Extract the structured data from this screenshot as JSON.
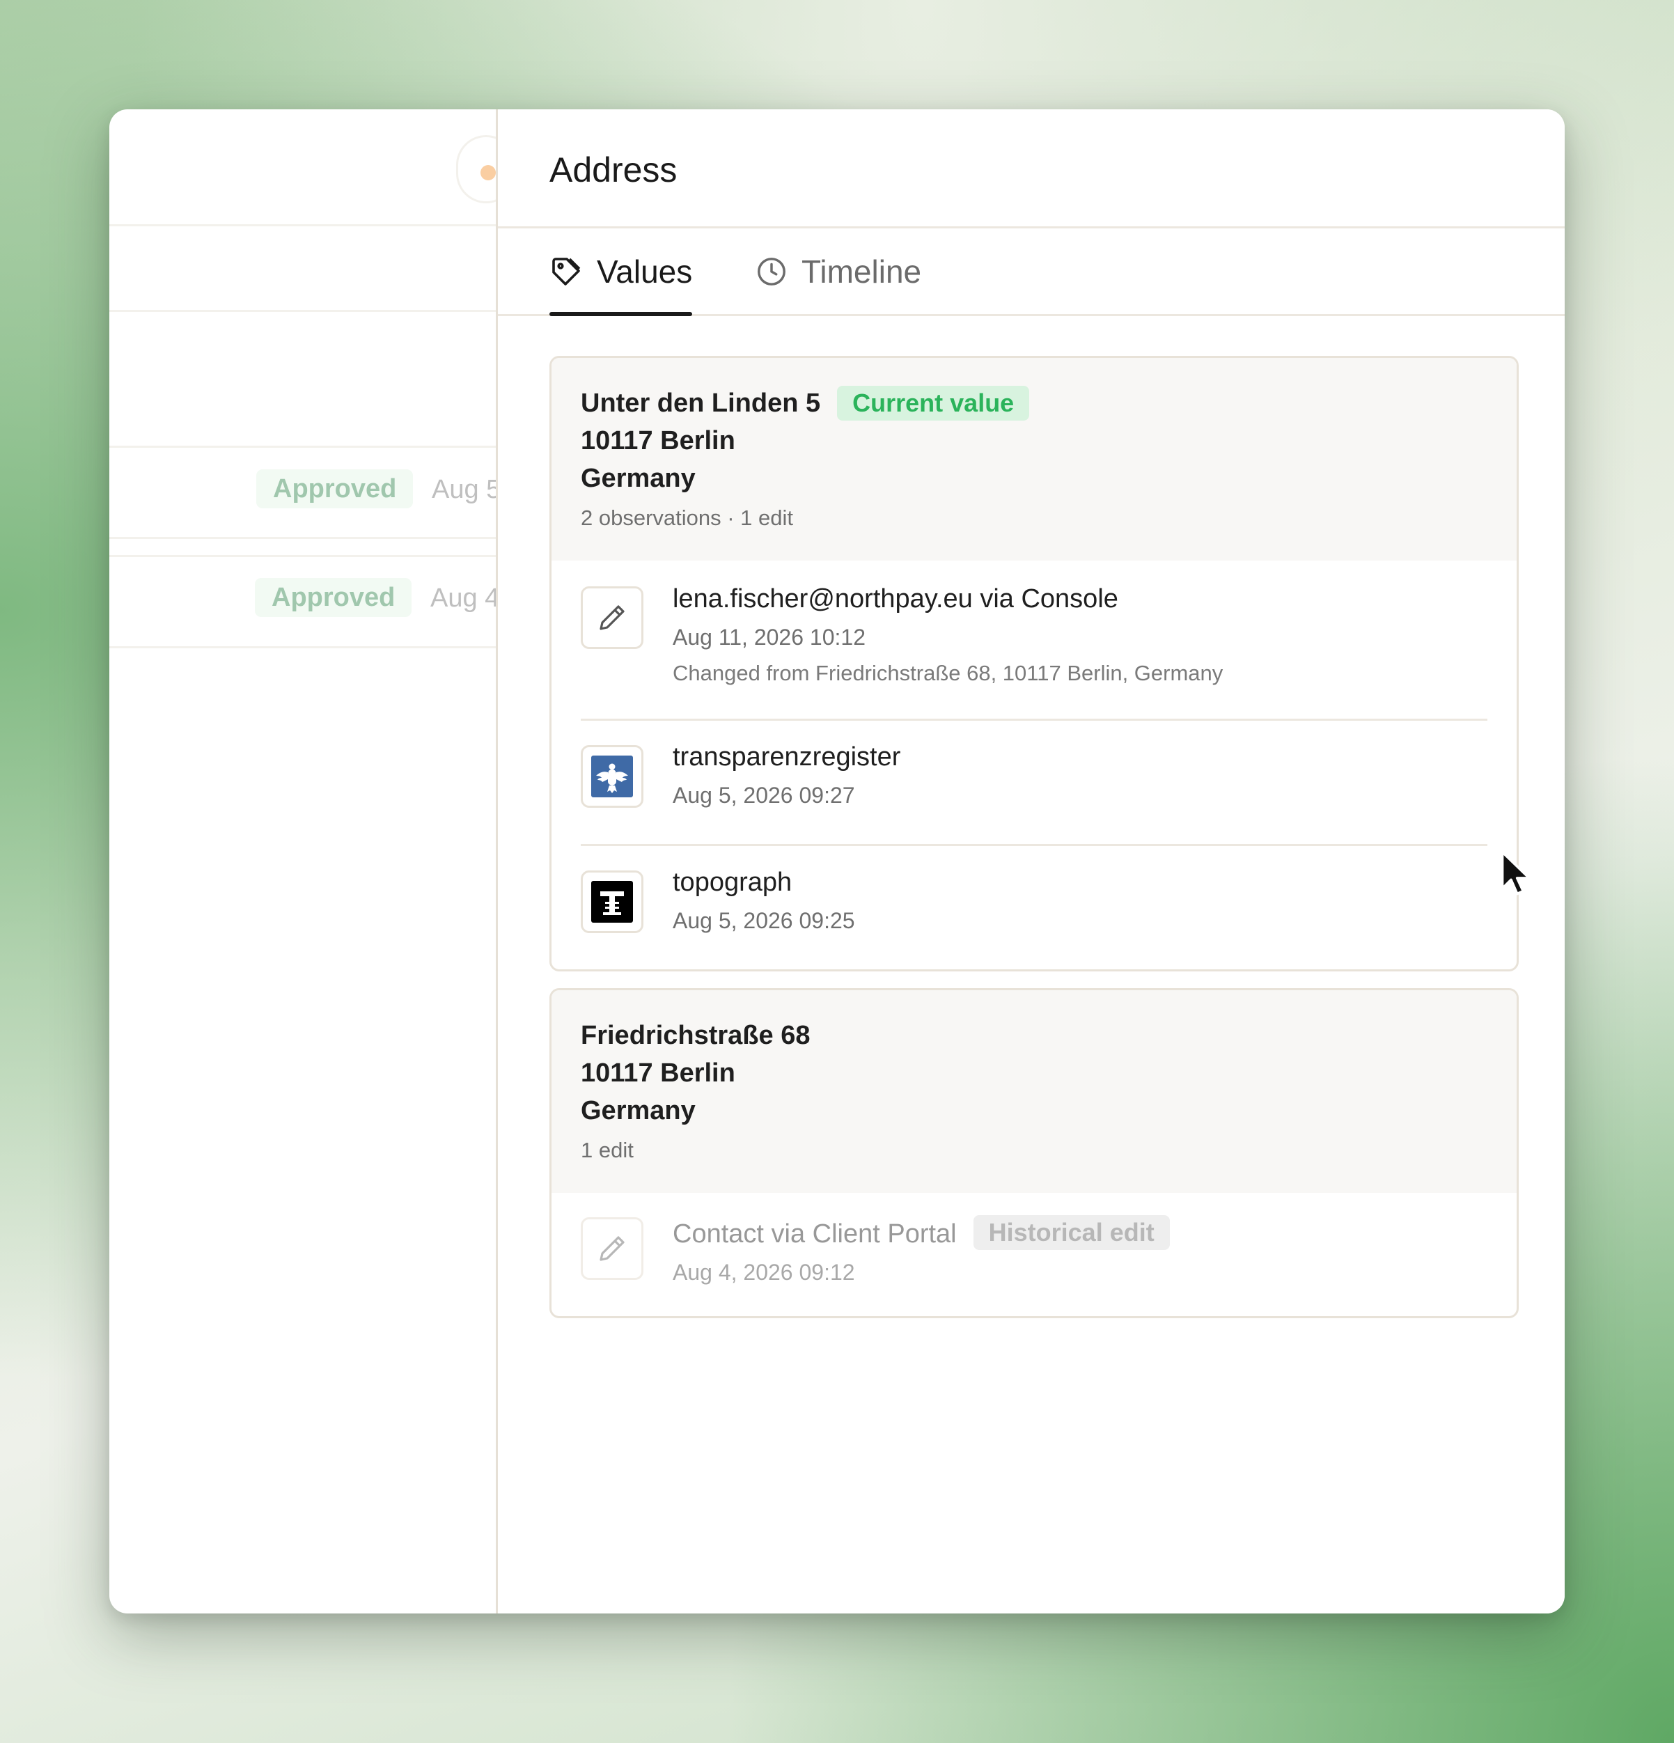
{
  "background_rows": [
    {
      "status": "Approved",
      "date": "Aug 5"
    },
    {
      "status": "Approved",
      "date": "Aug 4"
    }
  ],
  "drawer": {
    "title": "Address",
    "tabs": [
      {
        "label": "Values",
        "icon": "tag-icon",
        "active": true
      },
      {
        "label": "Timeline",
        "icon": "clock-icon",
        "active": false
      }
    ],
    "values": [
      {
        "address_lines": [
          "Unter den Linden 5",
          "10117 Berlin",
          "Germany"
        ],
        "badge": "Current value",
        "summary": "2 observations · 1 edit",
        "entries": [
          {
            "source": "lena.fischer@northpay.eu via Console",
            "icon": "pencil-icon",
            "timestamp": "Aug 11, 2026 10:12",
            "note": "Changed from Friedrichstraße 68, 10117 Berlin, Germany"
          },
          {
            "source": "transparenzregister",
            "icon": "eagle-logo-icon",
            "timestamp": "Aug 5, 2026 09:27"
          },
          {
            "source": "topograph",
            "icon": "topograph-logo-icon",
            "timestamp": "Aug 5, 2026 09:25"
          }
        ]
      },
      {
        "address_lines": [
          "Friedrichstraße 68",
          "10117 Berlin",
          "Germany"
        ],
        "summary": "1 edit",
        "entries": [
          {
            "source": "Contact via Client Portal",
            "icon": "pencil-icon",
            "badge": "Historical edit",
            "timestamp": "Aug 4, 2026 09:12"
          }
        ]
      }
    ]
  },
  "colors": {
    "current_badge_bg": "#d8f3df",
    "current_badge_text": "#2bb35b",
    "approved_badge_bg": "#dff2e2",
    "approved_badge_text": "#1e7a3c",
    "status_dot": "#f28a23",
    "historical_badge_bg": "#e3e3e3"
  }
}
